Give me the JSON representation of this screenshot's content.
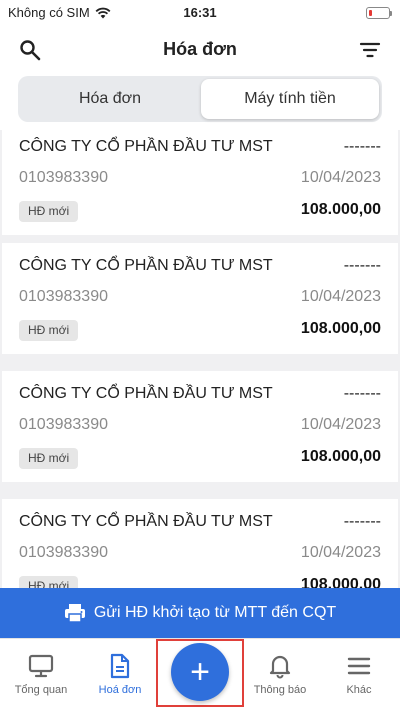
{
  "status_bar": {
    "carrier": "Không có SIM",
    "time": "16:31"
  },
  "header": {
    "title": "Hóa đơn"
  },
  "segment": {
    "left": "Hóa đơn",
    "right": "Máy tính tiền"
  },
  "invoices": [
    {
      "company": "CÔNG TY CỔ PHẦN ĐẦU TƯ MST",
      "status": "-------",
      "tax_code": "0103983390",
      "date": "10/04/2023",
      "badge": "HĐ mới",
      "amount": "108.000,00"
    },
    {
      "company": "CÔNG TY CỔ PHẦN ĐẦU TƯ MST",
      "status": "-------",
      "tax_code": "0103983390",
      "date": "10/04/2023",
      "badge": "HĐ mới",
      "amount": "108.000,00"
    },
    {
      "company": "CÔNG TY CỔ PHẦN ĐẦU TƯ MST",
      "status": "-------",
      "tax_code": "0103983390",
      "date": "10/04/2023",
      "badge": "HĐ mới",
      "amount": "108.000,00"
    },
    {
      "company": "CÔNG TY CỔ PHẦN ĐẦU TƯ MST",
      "status": "-------",
      "tax_code": "0103983390",
      "date": "10/04/2023",
      "badge": "HĐ mới",
      "amount": "108.000,00"
    }
  ],
  "send_bar": {
    "label": "Gửi HĐ khởi tạo từ MTT đến CQT"
  },
  "tabbar": {
    "overview": "Tổng quan",
    "invoices": "Hoá đơn",
    "add": "+",
    "notifications": "Thông báo",
    "more": "Khác"
  },
  "colors": {
    "accent": "#2f6fdc",
    "highlight_border": "#e0403a",
    "battery_low": "#e53935"
  },
  "icons": [
    "wifi-icon",
    "battery-icon",
    "search-icon",
    "filter-icon",
    "printer-icon",
    "monitor-icon",
    "document-icon",
    "plus-icon",
    "bell-icon",
    "menu-icon"
  ]
}
